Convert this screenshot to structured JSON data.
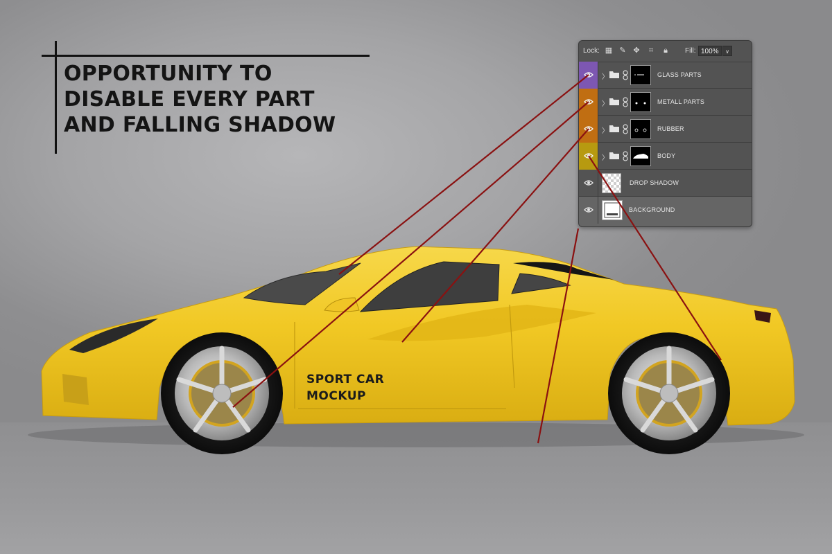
{
  "headline": {
    "text": "OPPORTUNITY TO DISABLE EVERY PART AND FALLING SHADOW"
  },
  "car_label": {
    "line1": "SPORT CAR",
    "line2": "MOCKUP"
  },
  "layers_panel": {
    "lock_label": "Lock:",
    "lock_icons": [
      "transparency-lock-icon",
      "brush-lock-icon",
      "move-lock-icon",
      "artboard-lock-icon",
      "padlock-icon"
    ],
    "fill_label": "Fill:",
    "fill_value": "100%",
    "layers": [
      {
        "name": "GLASS PARTS",
        "type": "group",
        "tag_color": "#7d57b2"
      },
      {
        "name": "METALL PARTS",
        "type": "group",
        "tag_color": "#c06e12"
      },
      {
        "name": "RUBBER",
        "type": "group",
        "tag_color": "#c06e12"
      },
      {
        "name": "BODY",
        "type": "group",
        "tag_color": "#b79a10"
      },
      {
        "name": "DROP SHADOW",
        "type": "layer",
        "tag_color": null
      },
      {
        "name": "BACKGROUND",
        "type": "layer",
        "tag_color": null
      }
    ]
  },
  "colors": {
    "car_body": "#f2c92a",
    "pointer_line": "#8a1111",
    "panel_bg": "#535353"
  }
}
